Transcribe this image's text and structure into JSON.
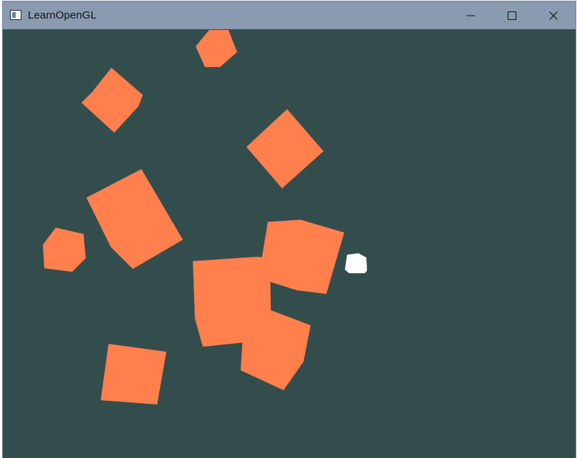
{
  "window": {
    "title": "LearnOpenGL",
    "app_icon": "opengl-window-icon",
    "controls": {
      "minimize_icon": "minimize-icon",
      "maximize_icon": "maximize-icon",
      "close_icon": "close-icon"
    }
  },
  "scene": {
    "clear_color": "#334d4d",
    "object_color": "#ff7f4d",
    "light_color": "#ffffff"
  }
}
